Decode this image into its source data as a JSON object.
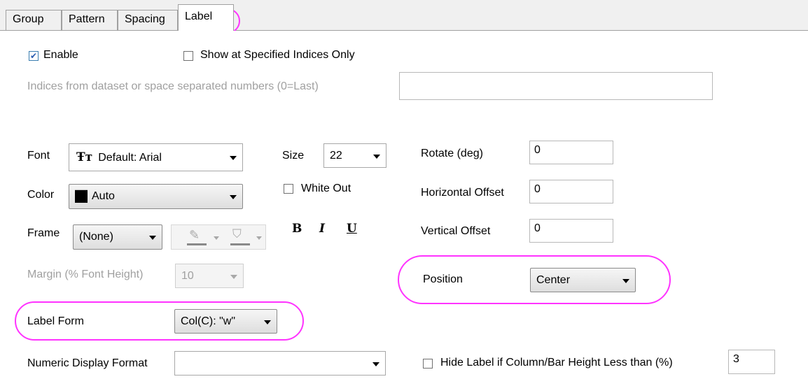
{
  "tabs": [
    {
      "label": "Group"
    },
    {
      "label": "Pattern"
    },
    {
      "label": "Spacing"
    },
    {
      "label": "Label"
    }
  ],
  "enable": {
    "label": "Enable",
    "checked": true
  },
  "show_specified": {
    "label": "Show at Specified Indices Only",
    "checked": false
  },
  "indices": {
    "label": "Indices from dataset or space separated numbers (0=Last)",
    "value": ""
  },
  "font": {
    "label": "Font",
    "value": "Default: Arial",
    "icon": "truetype-font-icon"
  },
  "size": {
    "label": "Size",
    "value": "22"
  },
  "rotate": {
    "label": "Rotate (deg)",
    "value": "0"
  },
  "color": {
    "label": "Color",
    "value": "Auto",
    "swatch": "#000000"
  },
  "white_out": {
    "label": "White Out",
    "checked": false
  },
  "horizontal_offset": {
    "label": "Horizontal Offset",
    "value": "0"
  },
  "frame": {
    "label": "Frame",
    "value": "(None)"
  },
  "format_buttons": {
    "bold": "B",
    "italic": "I",
    "underline": "U"
  },
  "vertical_offset": {
    "label": "Vertical Offset",
    "value": "0"
  },
  "margin": {
    "label": "Margin (% Font Height)",
    "value": "10"
  },
  "position": {
    "label": "Position",
    "value": "Center"
  },
  "label_form": {
    "label": "Label Form",
    "value": "Col(C): \"w\""
  },
  "numeric_format": {
    "label": "Numeric Display Format",
    "value": ""
  },
  "hide_label": {
    "label": "Hide Label if Column/Bar Height Less than (%)",
    "checked": false,
    "value": "3"
  },
  "highlight_color": "#ff33ff"
}
